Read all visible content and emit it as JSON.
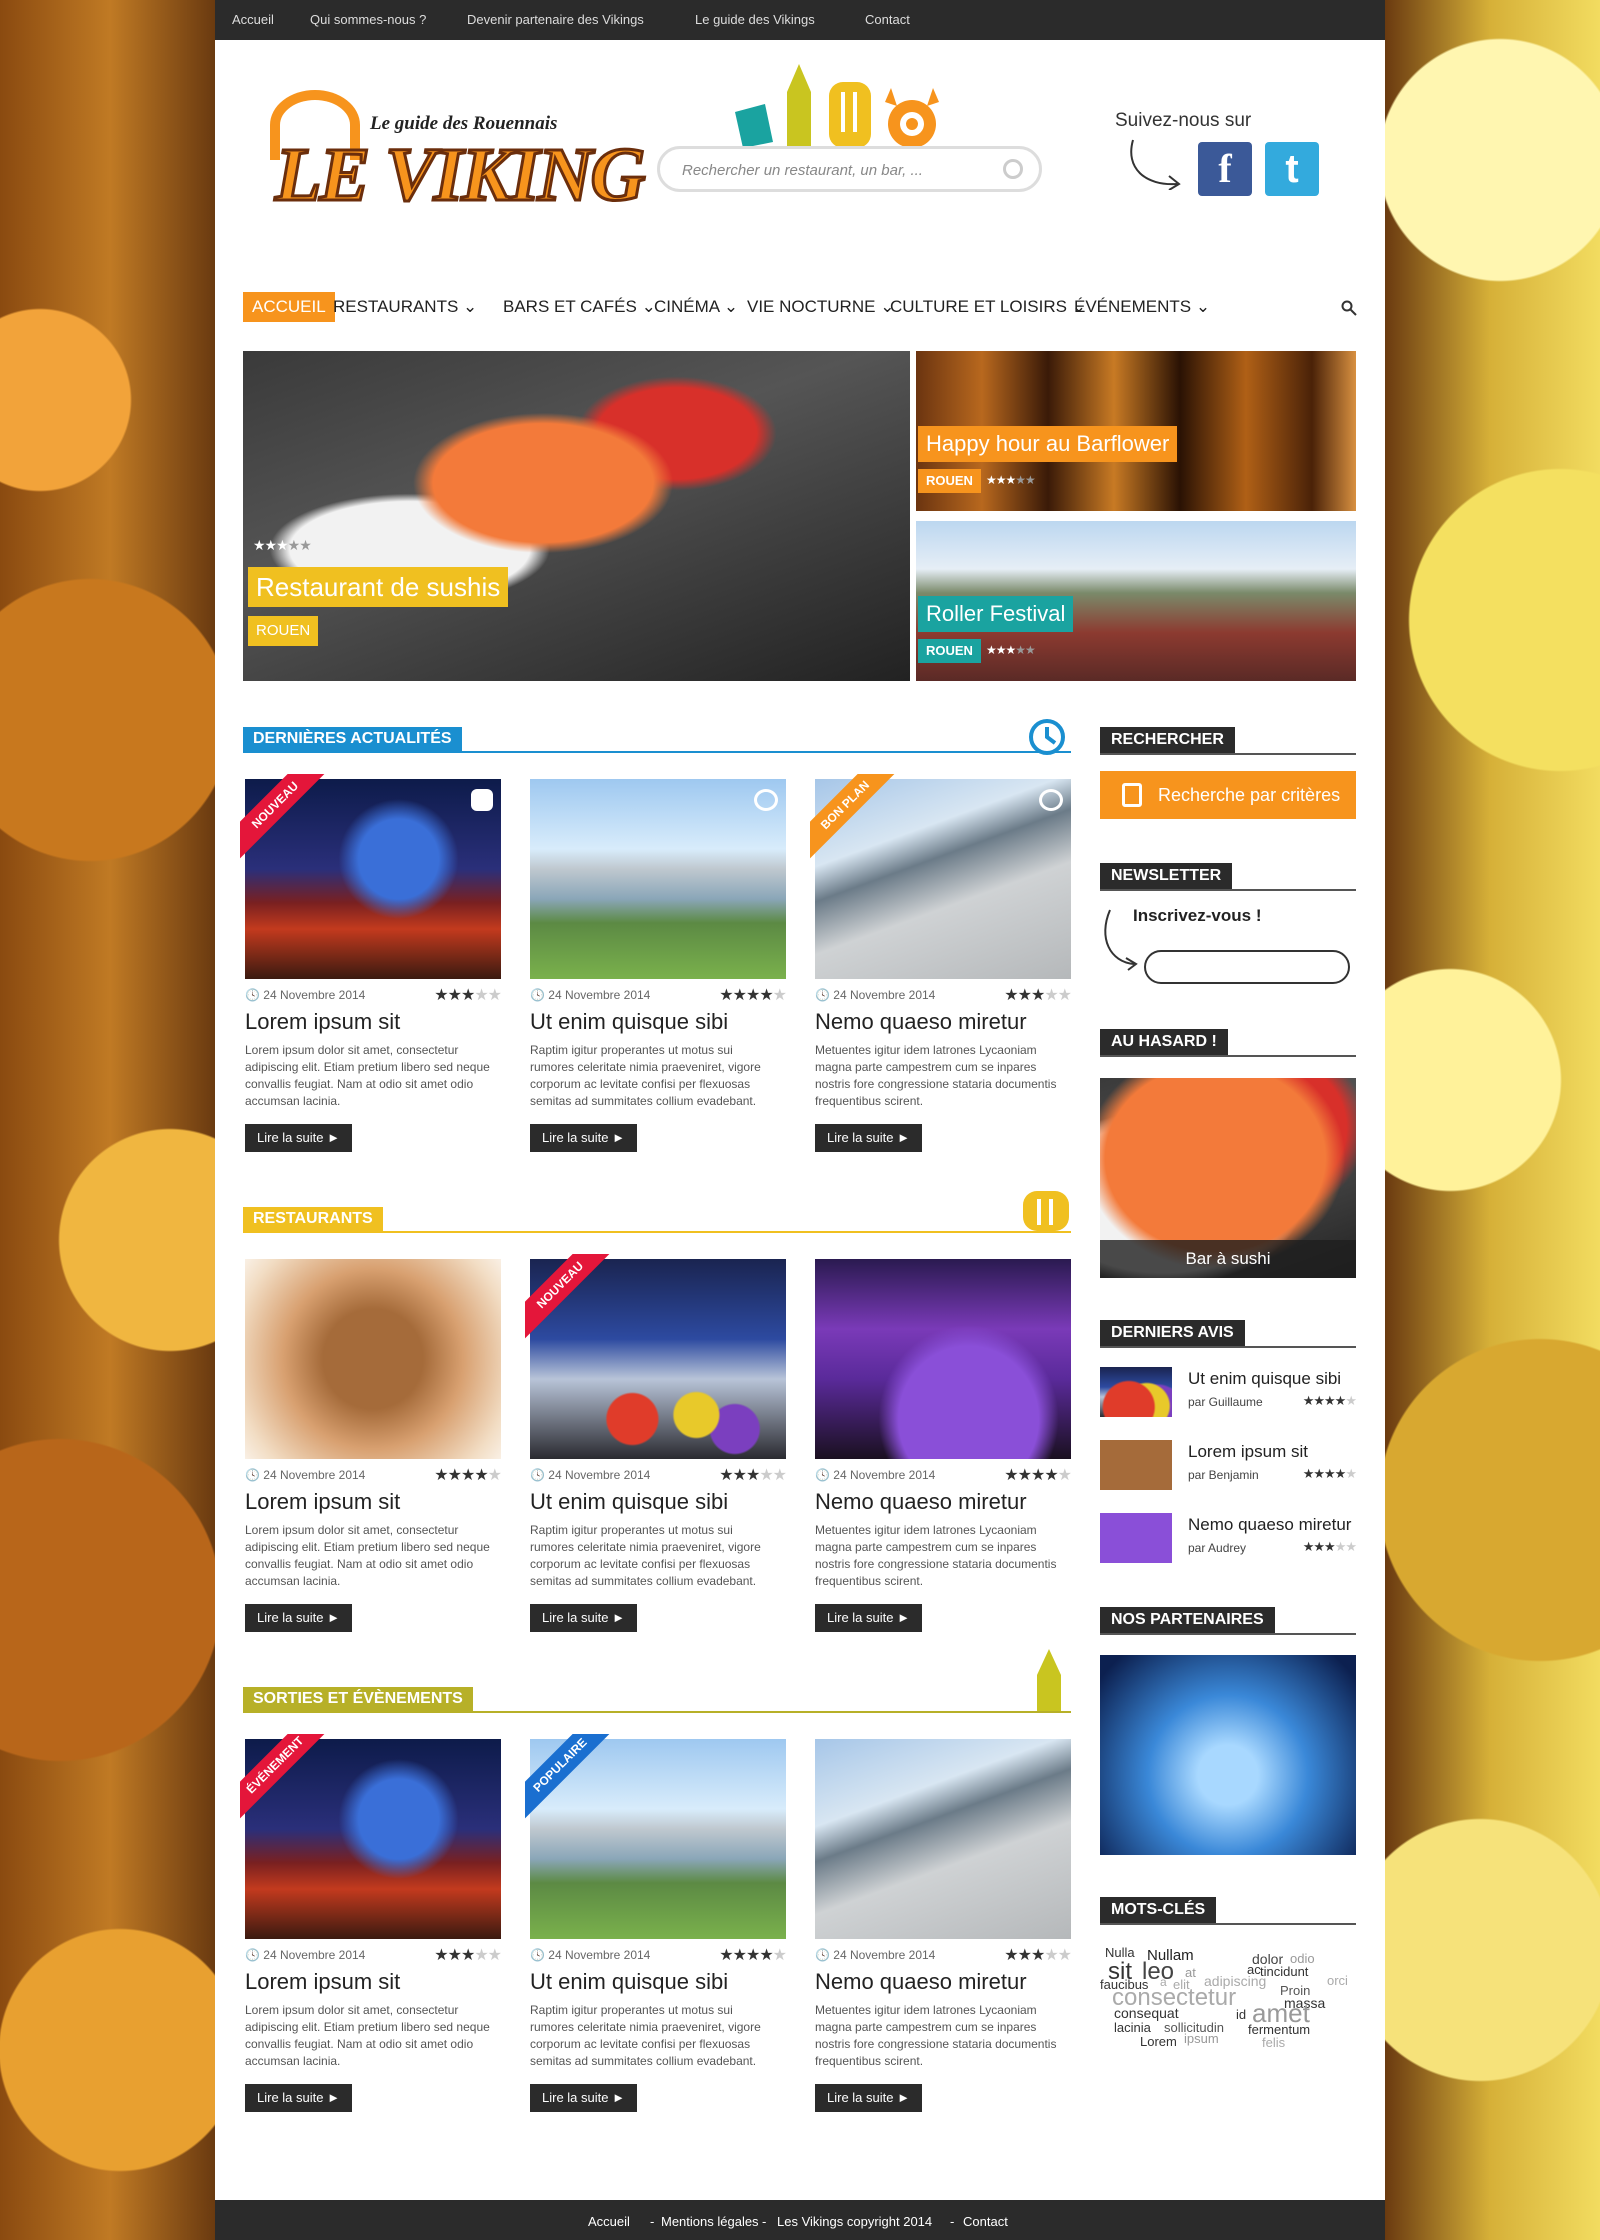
{
  "topnav": [
    "Accueil",
    "Qui sommes-nous ?",
    "Devenir partenaire des Vikings",
    "Le guide des Vikings",
    "Contact"
  ],
  "logo": {
    "tagline": "Le guide des Rouennais",
    "name": "LE VIKING"
  },
  "search": {
    "placeholder": "Rechercher un restaurant, un bar, ..."
  },
  "social": {
    "label": "Suivez-nous sur",
    "facebook": "f",
    "twitter": "t"
  },
  "mainnav": [
    "ACCUEIL",
    "RESTAURANTS",
    "BARS ET CAFÉS",
    "CINÉMA",
    "VIE NOCTURNE",
    "CULTURE ET LOISIRS",
    "ÉVÉNEMENTS"
  ],
  "hero": {
    "main": {
      "title": "Restaurant de sushis",
      "city": "ROUEN"
    },
    "side1": {
      "title": "Happy hour au Barflower",
      "city": "ROUEN"
    },
    "side2": {
      "title": "Roller Festival",
      "city": "ROUEN"
    }
  },
  "sections": {
    "news": {
      "title": "DERNIÈRES ACTUALITÉS",
      "color": "#1a8fd0"
    },
    "resto": {
      "title": "RESTAURANTS",
      "color": "#f0c020"
    },
    "sorties": {
      "title": "SORTIES ET ÉVÈNEMENTS",
      "color": "#b7b028"
    }
  },
  "cards": {
    "date": "24 Novembre 2014",
    "t1": "Lorem ipsum sit",
    "t2": "Ut enim quisque sibi",
    "t3": "Nemo quaeso miretur",
    "x1": "Lorem ipsum dolor sit amet, consectetur adipiscing elit. Etiam pretium libero sed neque convallis feugiat. Nam at odio sit amet odio accumsan lacinia.",
    "x2": "Raptim igitur properantes ut motus sui rumores celeritate nimia praeveniret, vigore corporum ac levitate confisi per flexuosas semitas ad summitates collium evadebant.",
    "x3": "Metuentes igitur idem latrones Lycaoniam magna parte campestrem cum se inpares nostris fore congressione stataria documentis frequentibus scirent.",
    "more": "Lire la suite ►",
    "badges": {
      "nouveau": "NOUVEAU",
      "bonplan": "BON PLAN",
      "evenement": "ÉVÉNEMENT",
      "populaire": "POPULAIRE"
    }
  },
  "sidebar": {
    "search": {
      "title": "RECHERCHER",
      "button": "Recherche par critères"
    },
    "newsletter": {
      "title": "NEWSLETTER",
      "label": "Inscrivez-vous !"
    },
    "random": {
      "title": "AU HASARD !",
      "caption": "Bar à sushi"
    },
    "reviews": {
      "title": "DERNIERS AVIS",
      "items": [
        {
          "t": "Ut enim quisque sibi",
          "by": "par Guillaume"
        },
        {
          "t": "Lorem ipsum sit",
          "by": "par Benjamin"
        },
        {
          "t": "Nemo quaeso miretur",
          "by": "par Audrey"
        }
      ]
    },
    "partners": {
      "title": "NOS PARTENAIRES"
    },
    "keywords": {
      "title": "MOTS-CLÉS",
      "words": [
        "Nulla",
        "Nullam",
        "sit",
        "leo",
        "at",
        "faucibus",
        "a",
        "elit",
        "adipiscing",
        "dolor",
        "odio",
        "ac",
        "tincidunt",
        "orci",
        "consectetur",
        "Proin",
        "massa",
        "consequat",
        "id",
        "amet",
        "lacinia",
        "sollicitudin",
        "fermentum",
        "Lorem",
        "ipsum",
        "felis"
      ]
    }
  },
  "footer": [
    "Accueil",
    "Mentions légales",
    "Les Vikings copyright 2014",
    "Contact"
  ]
}
